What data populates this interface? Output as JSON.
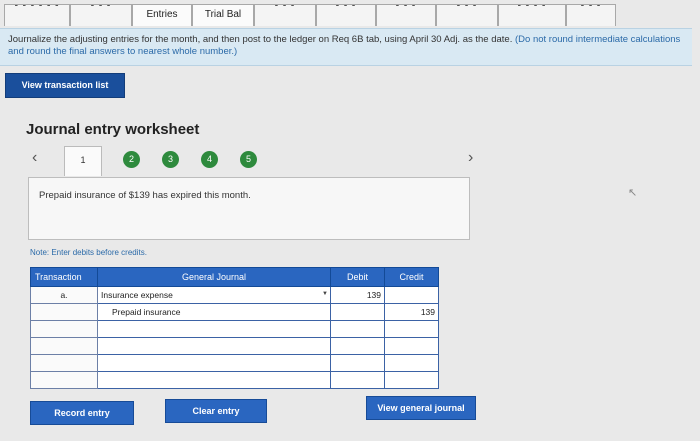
{
  "tabs": [
    {
      "label": "",
      "light": false
    },
    {
      "label": "",
      "light": false
    },
    {
      "label": "Entries",
      "light": true
    },
    {
      "label": "Trial Bal",
      "light": true
    },
    {
      "label": "",
      "light": false
    },
    {
      "label": "",
      "light": false
    },
    {
      "label": "",
      "light": false
    },
    {
      "label": "",
      "light": false
    },
    {
      "label": "",
      "light": false
    },
    {
      "label": "",
      "light": false
    }
  ],
  "instructions": {
    "main": "Journalize the adjusting entries for the month, and then post to the ledger on Req 6B tab, using April 30 Adj. as the date.",
    "note": "(Do not round intermediate calculations and round the final answers to nearest whole number.)"
  },
  "view_transaction_list": "View transaction list",
  "worksheet": {
    "title": "Journal entry worksheet",
    "steps": [
      "1",
      "2",
      "3",
      "4",
      "5"
    ],
    "active_step": "1",
    "description": "Prepaid insurance of $139 has expired this month.",
    "note": "Note: Enter debits before credits."
  },
  "journal": {
    "headers": {
      "transaction": "Transaction",
      "general_journal": "General Journal",
      "debit": "Debit",
      "credit": "Credit"
    },
    "rows": [
      {
        "transaction": "a.",
        "account": "Insurance expense",
        "debit": "139",
        "credit": ""
      },
      {
        "transaction": "",
        "account": "Prepaid insurance",
        "debit": "",
        "credit": "139"
      },
      {
        "transaction": "",
        "account": "",
        "debit": "",
        "credit": ""
      },
      {
        "transaction": "",
        "account": "",
        "debit": "",
        "credit": ""
      },
      {
        "transaction": "",
        "account": "",
        "debit": "",
        "credit": ""
      },
      {
        "transaction": "",
        "account": "",
        "debit": "",
        "credit": ""
      }
    ]
  },
  "buttons": {
    "record_entry": "Record entry",
    "clear_entry": "Clear entry",
    "view_general_journal": "View general journal"
  },
  "colors": {
    "accent": "#2a66c0",
    "step_green": "#2e8a3d",
    "banner": "#d9e9f3"
  }
}
